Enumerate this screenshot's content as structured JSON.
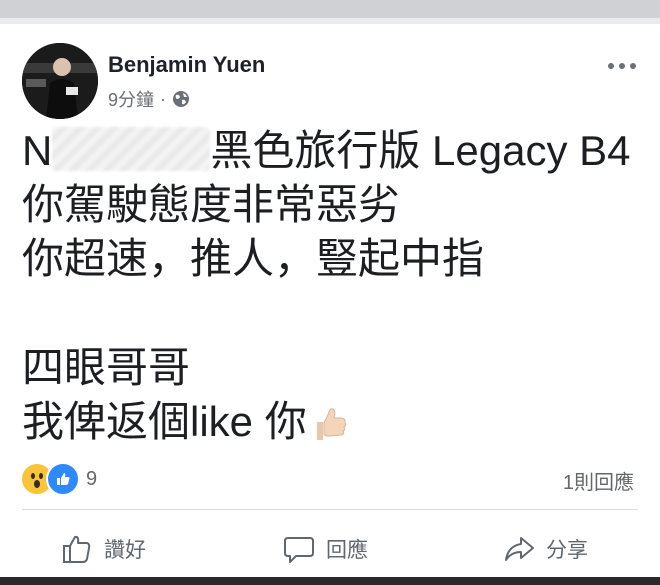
{
  "post": {
    "author": "Benjamin Yuen",
    "time": "9分鐘",
    "lines": {
      "l1_prefix": "N",
      "l1_rest": "黑色旅行版 Legacy B4",
      "l2": "你駕駛態度非常惡劣",
      "l3": "你超速，推人，豎起中指",
      "l4": "四眼哥哥",
      "l5": "我俾返個like 你"
    }
  },
  "stats": {
    "reaction_count": "9",
    "comment_count": "1則回應"
  },
  "actions": {
    "like": "讚好",
    "comment": "回應",
    "share": "分享"
  },
  "colors": {
    "like_blue": "#2e89ff",
    "wow_yellow": "#f7c43a"
  },
  "icons": [
    "globe-icon",
    "more-options-icon",
    "wow-reaction-icon",
    "like-reaction-icon",
    "thumbs-up-icon",
    "comment-icon",
    "share-icon",
    "thumbs-up-emoji"
  ]
}
